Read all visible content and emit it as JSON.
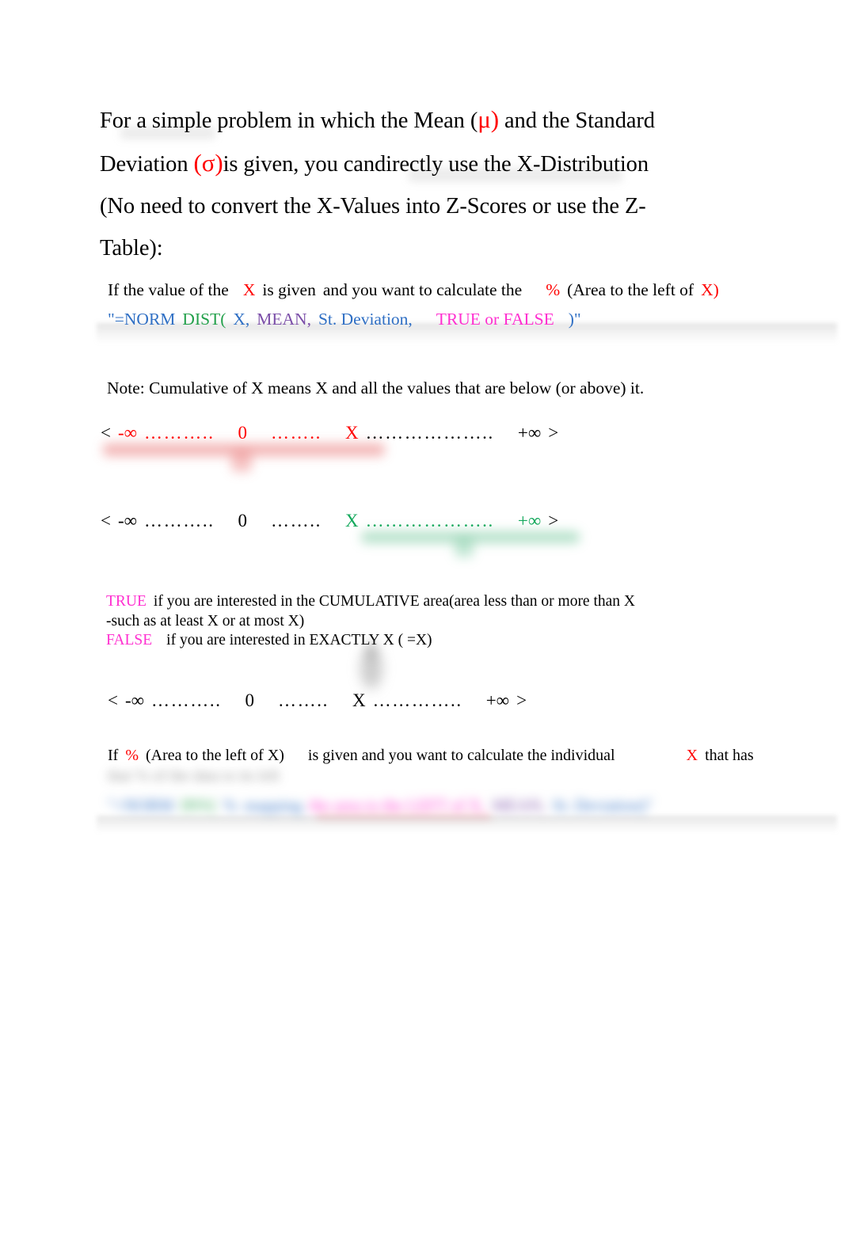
{
  "document": {
    "heading": {
      "line1_a": "For a simple problem in which the Mean (",
      "line1_mu": "μ)",
      "line1_b": " and the Standard",
      "line2_a": "Deviation ",
      "line2_sigma": "(σ)",
      "line2_b": "is given, you can",
      "line2_c": "directly use the X-Distribution",
      "line3": "(No need to convert the X-Values into Z-Scores or use the Z-",
      "line4": "Table):"
    },
    "formula_section": {
      "intro_a": "If the value of the",
      "intro_x": "X",
      "intro_b": "is given",
      "intro_c": "and you want to calculate the",
      "intro_pct": "%",
      "intro_d": "(Area to the left of",
      "intro_x2": "X)",
      "formula_quote_open": "\"=NORM",
      "formula_dist": "DIST(",
      "formula_x": "X,",
      "formula_mean": "MEAN,",
      "formula_sd": "St. Deviation,",
      "formula_bool": "TRUE or FALSE",
      "formula_quote_close": ")\""
    },
    "note": "Note: Cumulative of X means X and all the values that are below (or above) it.",
    "number_lines": [
      {
        "id": "numline-1",
        "lt": "<",
        "neg_inf": "-∞",
        "dots1": "………..",
        "zero": "0",
        "dots2": "……..",
        "x": "X",
        "dots3": "………………..",
        "pos_inf": "+∞",
        "gt": ">"
      },
      {
        "id": "numline-2",
        "lt": "<",
        "neg_inf": "-∞",
        "dots1": "………..",
        "zero": "0",
        "dots2": "……..",
        "x": "X",
        "dots3": "………………..",
        "pos_inf": "+∞",
        "gt": ">"
      },
      {
        "id": "numline-3",
        "lt": "<",
        "neg_inf": "-∞",
        "dots1": "………..",
        "zero": "0",
        "dots2": "……..",
        "x": "X",
        "dots3": "…………..",
        "pos_inf": "+∞",
        "gt": ">"
      }
    ],
    "true_false_block": {
      "true_label": "TRUE",
      "true_text": "if you are interested in the CUMULATIVE area(area less than or more than X",
      "true_text2": "-such as at least X or at most X)",
      "false_label": "FALSE",
      "false_text": "if you are interested in EXACTLY X ( =X)"
    },
    "bottom_section": {
      "if_label": "If",
      "pct": "%",
      "area_text": "(Area to the left of X)",
      "middle_text": "is given and you want to calculate the individual",
      "x_label": "X",
      "tail_text": "that has",
      "obscured_row_1": "that % of the data to its left",
      "obscured_row_2": "\"=NORM INV( % mapping the area to the LEFT of X, MEAN, St. Deviation)\""
    },
    "colors": {
      "red": "#ff0000",
      "green": "#12a85b",
      "blue": "#2f6fc4",
      "formula_green": "#22a04a",
      "purple": "#7b4ea8",
      "magenta": "#ff2fd0",
      "black": "#000000",
      "background": "#ffffff"
    }
  }
}
